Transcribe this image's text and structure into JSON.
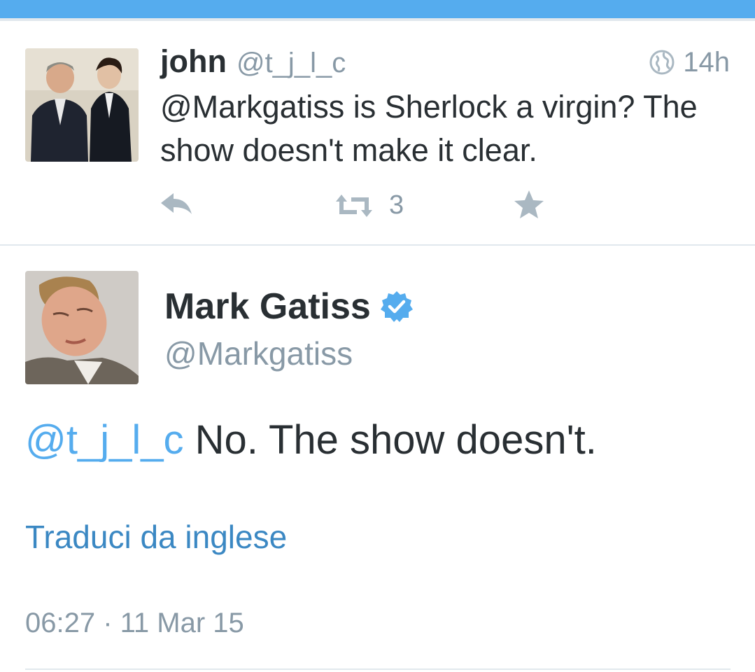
{
  "colors": {
    "accent": "#55acee",
    "link": "#3b88c3",
    "text": "#292f33",
    "muted": "#8899a6",
    "divider": "#e1e8ed"
  },
  "tweet_context": {
    "author_name": "john",
    "author_handle": "@t_j_l_c",
    "visibility_icon": "globe-icon",
    "time": "14h",
    "text": "@Markgatiss is Sherlock a virgin? The show doesn't make it clear.",
    "actions": {
      "reply_icon": "reply-icon",
      "retweet_icon": "retweet-icon",
      "retweet_count": "3",
      "favorite_icon": "star-icon"
    }
  },
  "tweet_main": {
    "author_name": "Mark Gatiss",
    "verified_icon": "verified-badge-icon",
    "author_handle": "@Markgatiss",
    "mention": "@t_j_l_c",
    "text": " No. The show doesn't.",
    "translate_link": "Traduci da inglese",
    "timestamp": "06:27 · 11 Mar 15"
  }
}
